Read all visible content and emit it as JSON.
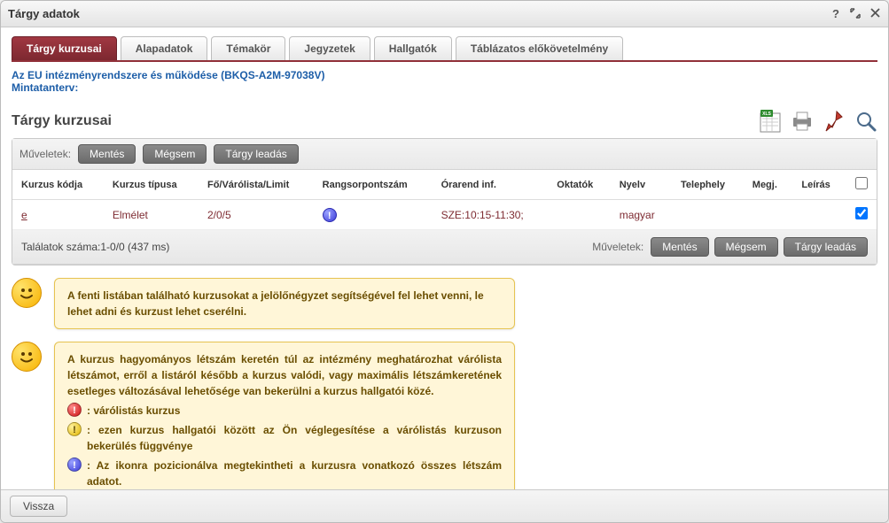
{
  "titlebar": {
    "title": "Tárgy adatok"
  },
  "tabs": [
    {
      "label": "Tárgy kurzusai",
      "active": true
    },
    {
      "label": "Alapadatok"
    },
    {
      "label": "Témakör"
    },
    {
      "label": "Jegyzetek"
    },
    {
      "label": "Hallgatók"
    },
    {
      "label": "Táblázatos előkövetelmény"
    }
  ],
  "subject": {
    "title": "Az EU intézményrendszere és működése (BKQS-A2M-97038V)",
    "subtitle": "Mintatanterv:"
  },
  "section_title": "Tárgy kurzusai",
  "ops_label": "Műveletek:",
  "buttons": {
    "save": "Mentés",
    "cancel": "Mégsem",
    "drop": "Tárgy leadás"
  },
  "table": {
    "headers": {
      "code": "Kurzus kódja",
      "type": "Kurzus típusa",
      "limit": "Fő/Várólista/Limit",
      "rank": "Rangsorpontszám",
      "schedule": "Órarend inf.",
      "instructors": "Oktatók",
      "lang": "Nyelv",
      "site": "Telephely",
      "note": "Megj.",
      "desc": "Leírás"
    },
    "rows": [
      {
        "code": "e",
        "type": "Elmélet",
        "limit": "2/0/5",
        "rank_icon": true,
        "schedule": "SZE:10:15-11:30;",
        "instructors": "",
        "lang": "magyar",
        "site": "",
        "note": "",
        "desc": "",
        "checked": true
      }
    ]
  },
  "results_text": "Találatok száma:1-0/0 (437 ms)",
  "hint1": "A fenti listában található kurzusokat a jelölőnégyzet segítségével fel lehet venni, le lehet adni és kurzust lehet cserélni.",
  "hint2": {
    "intro": "A kurzus hagyományos létszám keretén túl az intézmény meghatározhat várólista létszámot, erről a listáról később a kurzus valódi, vagy maximális létszámkeretének esetleges változásával lehetősége van bekerülni a kurzus hallgatói közé.",
    "red": ": várólistás kurzus",
    "yellow": ": ezen kurzus hallgatói között az Ön véglegesítése a várólistás kurzuson bekerülés függvénye",
    "blue": ": Az ikonra pozicionálva megtekintheti a kurzusra vonatkozó összes létszám adatot."
  },
  "footer": {
    "back": "Vissza"
  }
}
